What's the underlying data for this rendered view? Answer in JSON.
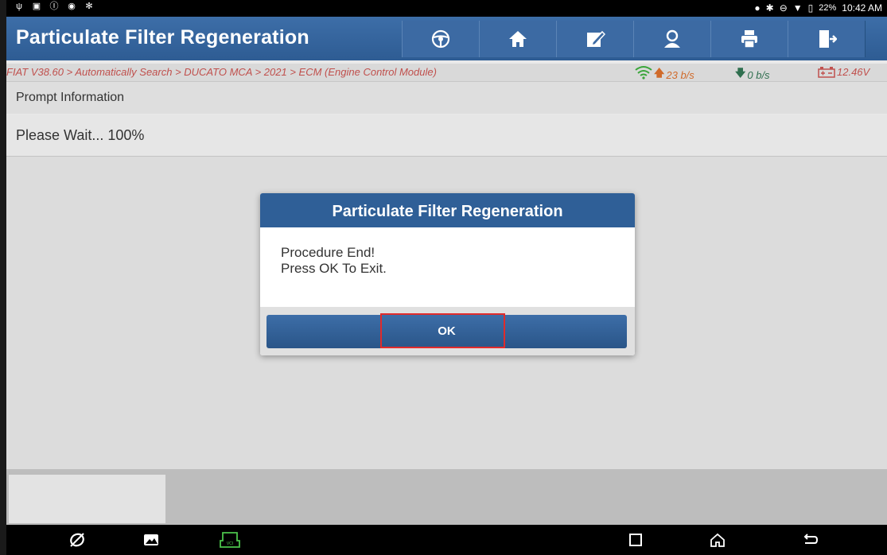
{
  "status_bar": {
    "battery": "22%",
    "time": "10:42 AM"
  },
  "header": {
    "title": "Particulate Filter Regeneration",
    "toolbar_icons": [
      "steering-wheel-icon",
      "home-icon",
      "edit-report-icon",
      "user-icon",
      "print-icon",
      "exit-icon"
    ]
  },
  "breadcrumb": {
    "path": "FIAT V38.60 > Automatically Search > DUCATO MCA > 2021 > ECM (Engine Control Module)",
    "upload_rate": "23 b/s",
    "download_rate": "0 b/s",
    "voltage": "12.46V"
  },
  "prompt": {
    "header": "Prompt Information",
    "message": "Please Wait... 100%"
  },
  "dialog": {
    "title": "Particulate Filter Regeneration",
    "line1": "Procedure End!",
    "line2": "Press OK To Exit.",
    "ok_label": "OK"
  },
  "colors": {
    "primary": "#2f5f97",
    "breadcrumb_text": "#c0504d",
    "highlight": "#e02b2b"
  }
}
